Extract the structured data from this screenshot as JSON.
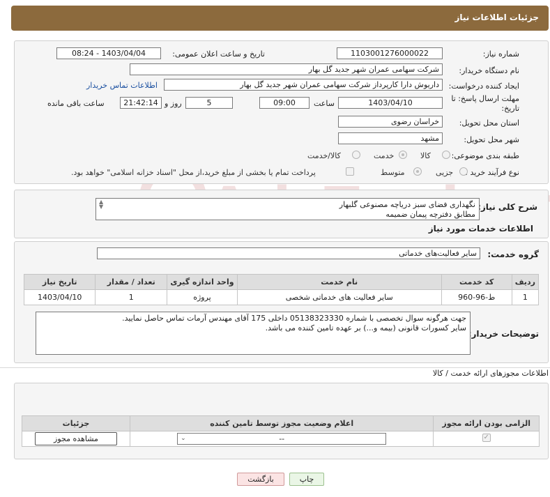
{
  "header": {
    "title": "جزئیات اطلاعات نیاز"
  },
  "info": {
    "need_number_label": "شماره نیاز:",
    "need_number": "1103001276000022",
    "announce_label": "تاریخ و ساعت اعلان عمومی:",
    "announce_value": "1403/04/04 - 08:24",
    "buyer_org_label": "نام دستگاه خریدار:",
    "buyer_org": "شرکت سهامی عمران شهر جدید گل بهار",
    "creator_label": "ایجاد کننده درخواست:",
    "creator": "داریوش دارا کارپرداز شرکت سهامی عمران شهر جدید گل بهار",
    "contact_link": "اطلاعات تماس خریدار",
    "deadline_label": "مهلت ارسال پاسخ: تا تاریخ:",
    "deadline_date": "1403/04/10",
    "time_label": "ساعت",
    "deadline_time": "09:00",
    "days_value": "5",
    "days_label": "روز و",
    "remaining_time": "21:42:14",
    "remaining_label": "ساعت باقی مانده",
    "province_label": "استان محل تحویل:",
    "province": "خراسان رضوی",
    "city_label": "شهر محل تحویل:",
    "city": "مشهد",
    "category_label": "طبقه بندی موضوعی:",
    "category_options": [
      "کالا",
      "خدمت",
      "کالا/خدمت"
    ],
    "process_label": "نوع فرآیند خرید :",
    "process_options": [
      "جزیی",
      "متوسط"
    ],
    "payment_note": "پرداخت تمام یا بخشی از مبلغ خرید،از محل \"اسناد خزانه اسلامی\" خواهد بود."
  },
  "summary": {
    "label": "شرح کلی نیاز:",
    "text": "نگهداری فضای سبز دریاچه مصنوعی گلبهار\nمطابق دفترچه پیمان ضمیمه"
  },
  "services": {
    "section_title": "اطلاعات خدمات مورد نیاز",
    "group_label": "گروه خدمت:",
    "group_value": "سایر فعالیت‌های خدماتی",
    "columns": [
      "ردیف",
      "کد خدمت",
      "نام خدمت",
      "واحد اندازه گیری",
      "تعداد / مقدار",
      "تاریخ نیاز"
    ],
    "rows": [
      [
        "1",
        "ط-96-960",
        "سایر فعالیت های خدماتی شخصی",
        "پروژه",
        "1",
        "1403/04/10"
      ]
    ]
  },
  "buyer_notes": {
    "label": "توضیحات خریدار:",
    "text": "جهت هرگونه سوال تخصصی با شماره 05138323330 داخلی 175 آقای مهندس آرمات تماس حاصل نمایید.\nسایر کسورات قانونی (بیمه و...) بر عهده تامین کننده می باشد."
  },
  "permits": {
    "section_title": "اطلاعات مجوزهای ارائه خدمت / کالا",
    "columns": [
      "الزامی بودن ارائه مجوز",
      "اعلام وضعیت مجوز توسط تامین کننده",
      "جزئیات"
    ],
    "select_value": "--",
    "view_button": "مشاهده مجوز"
  },
  "actions": {
    "print_button": "چاپ",
    "back_button": "بازگشت"
  },
  "watermark": {
    "text": "AriaTender.neT"
  }
}
